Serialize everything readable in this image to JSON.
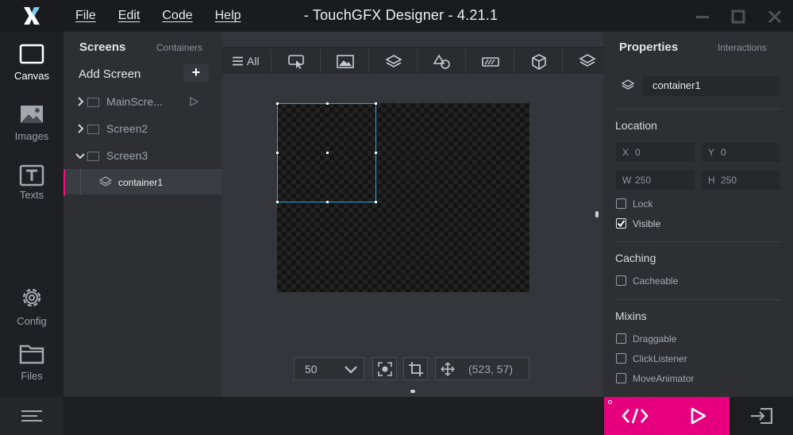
{
  "app": {
    "title": "- TouchGFX Designer - 4.21.1",
    "menu": [
      "File",
      "Edit",
      "Code",
      "Help"
    ]
  },
  "leftnav": {
    "items": [
      {
        "label": "Canvas",
        "icon": "canvas-icon",
        "active": true
      },
      {
        "label": "Images",
        "icon": "images-icon"
      },
      {
        "label": "Texts",
        "icon": "texts-icon"
      },
      {
        "label": "Config",
        "icon": "gear-icon"
      },
      {
        "label": "Files",
        "icon": "folder-icon"
      }
    ]
  },
  "tree": {
    "tab_active": "Screens",
    "tab_other": "Containers",
    "add_label": "Add Screen",
    "add_icon_text": "+",
    "rows": [
      {
        "label": "MainScre...",
        "expanded": false
      },
      {
        "label": "Screen2",
        "expanded": false
      },
      {
        "label": "Screen3",
        "expanded": true
      },
      {
        "label": "container1",
        "selected": true
      }
    ]
  },
  "canvas_toolbar": {
    "all_label": "All",
    "buttons": [
      "interaction-icon",
      "image-icon",
      "container-icon",
      "shapes-icon",
      "progress-icon",
      "3d-box-icon",
      "layers-icon"
    ]
  },
  "canvas": {
    "zoom": "50",
    "cursor_coords": "(523, 57)",
    "stage_background": "checkerboard",
    "selection_color": "#2aa7d8"
  },
  "properties": {
    "tab_active": "Properties",
    "tab_other": "Interactions",
    "name": "container1",
    "location_title": "Location",
    "x_key": "X",
    "x_val": "0",
    "y_key": "Y",
    "y_val": "0",
    "w_key": "W",
    "w_val": "250",
    "h_key": "H",
    "h_val": "250",
    "lock_label": "Lock",
    "visible_label": "Visible",
    "caching_title": "Caching",
    "cacheable_label": "Cacheable",
    "mixins_title": "Mixins",
    "draggable_label": "Draggable",
    "clicklistener_label": "ClickListener",
    "moveanimator_label": "MoveAnimator"
  },
  "colors": {
    "accent": "#e6007e",
    "selection": "#2aa7d8"
  }
}
